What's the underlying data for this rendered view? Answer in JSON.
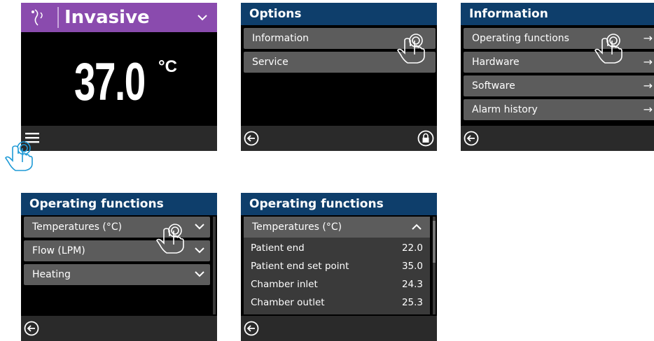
{
  "screen_home": {
    "mode": "Invasive",
    "temperature": "37.0",
    "unit": "°C"
  },
  "screen_options": {
    "title": "Options",
    "items": [
      "Information",
      "Service"
    ]
  },
  "screen_information": {
    "title": "Information",
    "items": [
      "Operating functions",
      "Hardware",
      "Software",
      "Alarm history"
    ],
    "arrow": "→"
  },
  "screen_operating_collapsed": {
    "title": "Operating functions",
    "items": [
      "Temperatures (°C)",
      "Flow (LPM)",
      "Heating"
    ]
  },
  "screen_operating_expanded": {
    "title": "Operating functions",
    "section": "Temperatures (°C)",
    "rows": [
      {
        "label": "Patient end",
        "value": "22.0"
      },
      {
        "label": "Patient end set point",
        "value": "35.0"
      },
      {
        "label": "Chamber inlet",
        "value": "24.3"
      },
      {
        "label": "Chamber outlet",
        "value": "25.3"
      }
    ]
  },
  "colors": {
    "header_blue": "#0e3e6b",
    "mode_purple": "#8a4bae",
    "row_gray": "#5c5c5c",
    "hand_cyan": "#1e9ad6"
  },
  "icons": [
    "back-icon",
    "lock-icon",
    "menu-icon",
    "chevron-down-icon",
    "chevron-up-icon",
    "tap-hand-icon",
    "patient-mode-icon"
  ]
}
